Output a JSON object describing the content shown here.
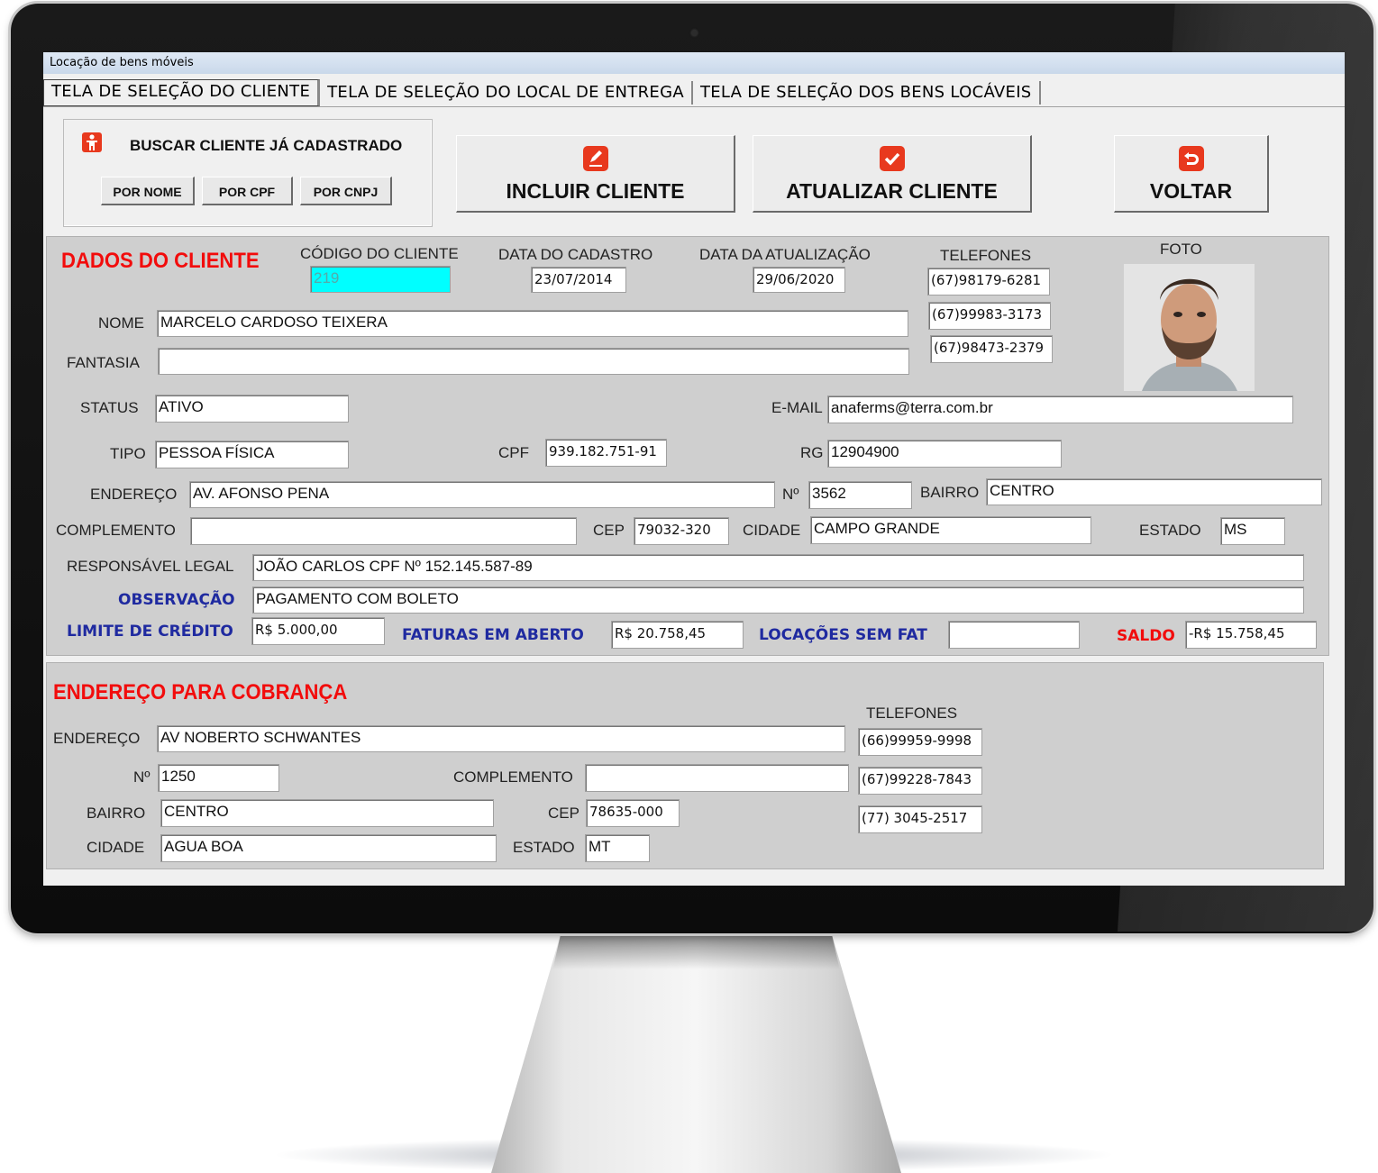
{
  "window": {
    "title": "Locação de bens móveis"
  },
  "tabs": [
    {
      "label": "TELA DE SELEÇÃO DO CLIENTE"
    },
    {
      "label": "TELA DE SELEÇÃO DO LOCAL DE ENTREGA"
    },
    {
      "label": "TELA DE SELEÇÃO DOS BENS LOCÁVEIS"
    }
  ],
  "search": {
    "title": "BUSCAR CLIENTE JÁ CADASTRADO",
    "by_name": "POR NOME",
    "by_cpf": "POR CPF",
    "by_cnpj": "POR CNPJ"
  },
  "actions": {
    "include": "INCLUIR CLIENTE",
    "update": "ATUALIZAR CLIENTE",
    "back": "VOLTAR"
  },
  "cliente": {
    "section_title": "DADOS DO CLIENTE",
    "codigo_label": "CÓDIGO DO CLIENTE",
    "codigo": "219",
    "cadastro_label": "DATA DO CADASTRO",
    "cadastro": "23/07/2014",
    "atualizacao_label": "DATA DA ATUALIZAÇÃO",
    "atualizacao": "29/06/2020",
    "telefones_label": "TELEFONES",
    "telefones": [
      "(67)98179-6281",
      "(67)99983-3173",
      "(67)98473-2379"
    ],
    "foto_label": "FOTO",
    "nome_label": "NOME",
    "nome": "MARCELO CARDOSO TEIXERA",
    "fantasia_label": "FANTASIA",
    "fantasia": "",
    "status_label": "STATUS",
    "status": "ATIVO",
    "email_label": "E-MAIL",
    "email": "anaferms@terra.com.br",
    "tipo_label": "TIPO",
    "tipo": "PESSOA FÍSICA",
    "cpf_label": "CPF",
    "cpf": "939.182.751-91",
    "rg_label": "RG",
    "rg": "12904900",
    "endereco_label": "ENDEREÇO",
    "endereco": "AV. AFONSO PENA",
    "numero_label": "Nº",
    "numero": "3562",
    "bairro_label": "BAIRRO",
    "bairro": "CENTRO",
    "complemento_label": "COMPLEMENTO",
    "complemento": "",
    "cep_label": "CEP",
    "cep": "79032-320",
    "cidade_label": "CIDADE",
    "cidade": "CAMPO GRANDE",
    "estado_label": "ESTADO",
    "estado": "MS",
    "responsavel_label": "RESPONSÁVEL LEGAL",
    "responsavel": "JOÃO CARLOS CPF Nº 152.145.587-89",
    "observacao_label": "OBSERVAÇÃO",
    "observacao": "PAGAMENTO COM BOLETO",
    "limite_label": "LIMITE DE CRÉDITO",
    "limite": "R$ 5.000,00",
    "faturas_label": "FATURAS EM ABERTO",
    "faturas": "R$ 20.758,45",
    "locacoes_label": "LOCAÇÕES SEM FAT",
    "locacoes": "",
    "saldo_label": "SALDO",
    "saldo": "-R$ 15.758,45"
  },
  "cobranca": {
    "section_title": "ENDEREÇO PARA COBRANÇA",
    "telefones_label": "TELEFONES",
    "telefones": [
      "(66)99959-9998",
      "(67)99228-7843",
      "(77) 3045-2517"
    ],
    "endereco_label": "ENDEREÇO",
    "endereco": "AV NOBERTO SCHWANTES",
    "numero_label": "Nº",
    "numero": "1250",
    "complemento_label": "COMPLEMENTO",
    "complemento": "",
    "bairro_label": "BAIRRO",
    "bairro": "CENTRO",
    "cep_label": "CEP",
    "cep": "78635-000",
    "cidade_label": "CIDADE",
    "cidade": "AGUA BOA",
    "estado_label": "ESTADO",
    "estado": "MT"
  },
  "colors": {
    "accent_red": "#f20c0c",
    "label_blue": "#1f2aa0",
    "code_bg": "#00ffff",
    "panel": "#cfcfcf"
  },
  "icons": {
    "search": "person-icon",
    "include": "edit-icon",
    "update": "checkbox-icon",
    "back": "undo-icon"
  }
}
